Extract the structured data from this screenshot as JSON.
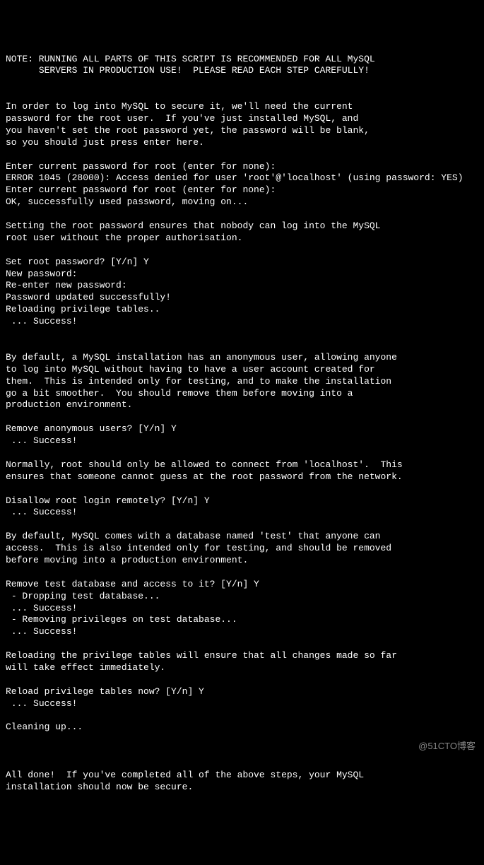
{
  "terminal": {
    "lines": [
      "NOTE: RUNNING ALL PARTS OF THIS SCRIPT IS RECOMMENDED FOR ALL MySQL",
      "      SERVERS IN PRODUCTION USE!  PLEASE READ EACH STEP CAREFULLY!",
      "",
      "",
      "In order to log into MySQL to secure it, we'll need the current",
      "password for the root user.  If you've just installed MySQL, and",
      "you haven't set the root password yet, the password will be blank,",
      "so you should just press enter here.",
      "",
      "Enter current password for root (enter for none):",
      "ERROR 1045 (28000): Access denied for user 'root'@'localhost' (using password: YES)",
      "Enter current password for root (enter for none):",
      "OK, successfully used password, moving on...",
      "",
      "Setting the root password ensures that nobody can log into the MySQL",
      "root user without the proper authorisation.",
      "",
      "Set root password? [Y/n] Y",
      "New password:",
      "Re-enter new password:",
      "Password updated successfully!",
      "Reloading privilege tables..",
      " ... Success!",
      "",
      "",
      "By default, a MySQL installation has an anonymous user, allowing anyone",
      "to log into MySQL without having to have a user account created for",
      "them.  This is intended only for testing, and to make the installation",
      "go a bit smoother.  You should remove them before moving into a",
      "production environment.",
      "",
      "Remove anonymous users? [Y/n] Y",
      " ... Success!",
      "",
      "Normally, root should only be allowed to connect from 'localhost'.  This",
      "ensures that someone cannot guess at the root password from the network.",
      "",
      "Disallow root login remotely? [Y/n] Y",
      " ... Success!",
      "",
      "By default, MySQL comes with a database named 'test' that anyone can",
      "access.  This is also intended only for testing, and should be removed",
      "before moving into a production environment.",
      "",
      "Remove test database and access to it? [Y/n] Y",
      " - Dropping test database...",
      " ... Success!",
      " - Removing privileges on test database...",
      " ... Success!",
      "",
      "Reloading the privilege tables will ensure that all changes made so far",
      "will take effect immediately.",
      "",
      "Reload privilege tables now? [Y/n] Y",
      " ... Success!",
      "",
      "Cleaning up...",
      "",
      "",
      "",
      "All done!  If you've completed all of the above steps, your MySQL",
      "installation should now be secure."
    ]
  },
  "watermark": "@51CTO博客"
}
